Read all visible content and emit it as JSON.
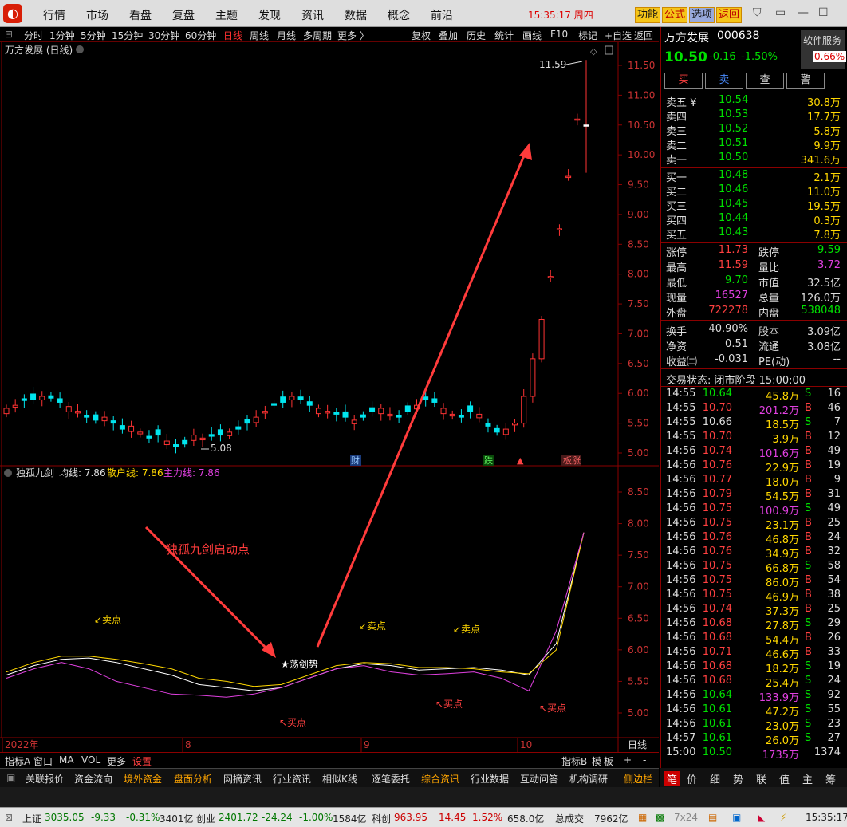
{
  "menu": {
    "items": [
      "行情",
      "市场",
      "看盘",
      "复盘",
      "主题",
      "发现",
      "资讯",
      "数据",
      "概念",
      "前沿"
    ],
    "clock": "15:35:17 周四",
    "func": [
      "功能",
      "公式",
      "选项",
      "返回"
    ]
  },
  "tf": {
    "items": [
      "分时",
      "1分钟",
      "5分钟",
      "15分钟",
      "30分钟",
      "60分钟",
      "日线",
      "周线",
      "月线",
      "多周期",
      "更多 〉"
    ],
    "tools": [
      "复权",
      "叠加",
      "历史",
      "统计",
      "画线",
      "F10",
      "标记",
      "+自选",
      "返回"
    ]
  },
  "chart": {
    "title": "万方发展 (日线)",
    "ind_title": "独孤九剑",
    "ind_avg": "均线: 7.86",
    "ind_retail": "散户线: 7.86",
    "ind_main": "主力线: 7.86",
    "yticks": [
      "11.50",
      "11.00",
      "10.50",
      "10.00",
      "9.50",
      "9.00",
      "8.50",
      "8.00",
      "7.50",
      "7.00",
      "6.50",
      "6.00",
      "5.50",
      "5.00"
    ],
    "yticks2": [
      "8.50",
      "8.00",
      "7.50",
      "7.00",
      "6.50",
      "6.00",
      "5.50",
      "5.00"
    ],
    "high_label": "11.59",
    "low_label": "5.08",
    "xlabels": [
      "2022年",
      "8",
      "9",
      "10"
    ],
    "xlast": "日线",
    "ann_launch": "独孤九剑启动点",
    "ann_sell": "卖点",
    "ann_buy": "买点",
    "ann_sword": "★荡剑势",
    "badge_cai": "财",
    "badge_die": "跌",
    "badge_zt": "涨"
  },
  "chart_data": [
    {
      "type": "candlestick",
      "title": "万方发展 (日线)",
      "ylim": [
        4.95,
        11.75
      ],
      "x": [
        "2022-06",
        "2022-07",
        "2022-08",
        "2022-09",
        "2022-10"
      ],
      "closes": [
        5.75,
        5.8,
        5.88,
        5.9,
        5.95,
        5.92,
        5.85,
        5.78,
        5.7,
        5.6,
        5.55,
        5.6,
        5.5,
        5.4,
        5.45,
        5.35,
        5.25,
        5.3,
        5.2,
        5.1,
        5.15,
        5.3,
        5.25,
        5.28,
        5.3,
        5.35,
        5.4,
        5.5,
        5.6,
        5.7,
        5.8,
        5.85,
        5.95,
        5.9,
        5.8,
        5.75,
        5.7,
        5.65,
        5.6,
        5.55,
        5.6,
        5.7,
        5.75,
        5.65,
        5.6,
        5.7,
        5.8,
        5.9,
        5.85,
        5.75,
        5.65,
        5.6,
        5.7,
        5.65,
        5.45,
        5.35,
        5.4,
        5.5,
        5.95,
        6.58,
        7.24,
        7.96,
        8.76,
        9.64,
        10.6,
        10.5
      ]
    },
    {
      "type": "line",
      "title": "独孤九剑",
      "ylim": [
        4.85,
        8.9
      ],
      "series": [
        {
          "name": "均线",
          "values": [
            5.6,
            5.75,
            5.85,
            5.87,
            5.8,
            5.7,
            5.6,
            5.45,
            5.4,
            5.35,
            5.4,
            5.55,
            5.7,
            5.78,
            5.75,
            5.68,
            5.7,
            5.72,
            5.68,
            5.6,
            6.1,
            7.86
          ]
        },
        {
          "name": "散户线",
          "values": [
            5.65,
            5.8,
            5.9,
            5.9,
            5.85,
            5.78,
            5.7,
            5.55,
            5.5,
            5.42,
            5.45,
            5.6,
            5.75,
            5.8,
            5.78,
            5.72,
            5.72,
            5.7,
            5.65,
            5.62,
            6.0,
            7.86
          ]
        },
        {
          "name": "主力线",
          "values": [
            5.55,
            5.7,
            5.8,
            5.7,
            5.5,
            5.4,
            5.3,
            5.28,
            5.25,
            5.3,
            5.4,
            5.55,
            5.7,
            5.75,
            5.65,
            5.6,
            5.62,
            5.65,
            5.55,
            5.35,
            6.3,
            7.86
          ]
        }
      ]
    }
  ],
  "quote": {
    "name": "万方发展",
    "code": "000638",
    "svc": "软件服务",
    "price": "10.50",
    "chg": "-0.16",
    "pct": "-1.50%",
    "rate": "0.66%",
    "btns": [
      "买",
      "卖",
      "查",
      "警"
    ],
    "sells": [
      [
        "卖五 ¥",
        "10.54",
        "30.8万"
      ],
      [
        "卖四",
        "10.53",
        "17.7万"
      ],
      [
        "卖三",
        "10.52",
        "5.8万"
      ],
      [
        "卖二",
        "10.51",
        "9.9万"
      ],
      [
        "卖一",
        "10.50",
        "341.6万"
      ]
    ],
    "buys": [
      [
        "买一",
        "10.48",
        "2.1万"
      ],
      [
        "买二",
        "10.46",
        "11.0万"
      ],
      [
        "买三",
        "10.45",
        "19.5万"
      ],
      [
        "买四",
        "10.44",
        "0.3万"
      ],
      [
        "买五",
        "10.43",
        "7.8万"
      ]
    ],
    "stats": [
      [
        "涨停",
        "11.73",
        "跌停",
        "9.59"
      ],
      [
        "最高",
        "11.59",
        "量比",
        "3.72"
      ],
      [
        "最低",
        "9.70",
        "市值",
        "32.5亿"
      ],
      [
        "现量",
        "16527",
        "总量",
        "126.0万"
      ],
      [
        "外盘",
        "722278",
        "内盘",
        "538048"
      ]
    ],
    "stats2": [
      [
        "换手",
        "40.90%",
        "股本",
        "3.09亿"
      ],
      [
        "净资",
        "0.51",
        "流通",
        "3.08亿"
      ],
      [
        "收益㈡",
        "-0.031",
        "PE(动)",
        "--"
      ]
    ],
    "trade_state": "交易状态: 闭市阶段 15:00:00",
    "ticks": [
      [
        "14:55",
        "10.64",
        "45.8万",
        "S",
        "16"
      ],
      [
        "14:55",
        "10.70",
        "201.2万",
        "B",
        "46"
      ],
      [
        "14:55",
        "10.66",
        "18.5万",
        "S",
        "7"
      ],
      [
        "14:55",
        "10.70",
        "3.9万",
        "B",
        "12"
      ],
      [
        "14:56",
        "10.74",
        "101.6万",
        "B",
        "49"
      ],
      [
        "14:56",
        "10.76",
        "22.9万",
        "B",
        "19"
      ],
      [
        "14:56",
        "10.77",
        "18.0万",
        "B",
        "9"
      ],
      [
        "14:56",
        "10.79",
        "54.5万",
        "B",
        "31"
      ],
      [
        "14:56",
        "10.75",
        "100.9万",
        "S",
        "49"
      ],
      [
        "14:56",
        "10.75",
        "23.1万",
        "B",
        "25"
      ],
      [
        "14:56",
        "10.76",
        "46.8万",
        "B",
        "24"
      ],
      [
        "14:56",
        "10.76",
        "34.9万",
        "B",
        "32"
      ],
      [
        "14:56",
        "10.75",
        "66.8万",
        "S",
        "58"
      ],
      [
        "14:56",
        "10.75",
        "86.0万",
        "B",
        "54"
      ],
      [
        "14:56",
        "10.75",
        "46.9万",
        "B",
        "38"
      ],
      [
        "14:56",
        "10.74",
        "37.3万",
        "B",
        "25"
      ],
      [
        "14:56",
        "10.68",
        "27.8万",
        "S",
        "29"
      ],
      [
        "14:56",
        "10.68",
        "54.4万",
        "B",
        "26"
      ],
      [
        "14:56",
        "10.71",
        "46.6万",
        "B",
        "33"
      ],
      [
        "14:56",
        "10.68",
        "18.2万",
        "S",
        "19"
      ],
      [
        "14:56",
        "10.68",
        "25.4万",
        "S",
        "24"
      ],
      [
        "14:56",
        "10.64",
        "133.9万",
        "S",
        "92"
      ],
      [
        "14:56",
        "10.61",
        "47.2万",
        "S",
        "55"
      ],
      [
        "14:56",
        "10.61",
        "23.0万",
        "S",
        "23"
      ],
      [
        "14:57",
        "10.61",
        "26.0万",
        "S",
        "27"
      ],
      [
        "15:00",
        "10.50",
        "1735万",
        "",
        "1374"
      ]
    ]
  },
  "bottom": {
    "ind_tabs": [
      "指标A",
      "窗口",
      "MA",
      "VOL",
      "更多",
      "设置"
    ],
    "right": [
      "指标B",
      "模",
      "板",
      "+",
      "-"
    ],
    "tabs": [
      "关联报价",
      "资金流向",
      "境外资金",
      "盘面分析",
      "网摘资讯",
      "行业资讯",
      "相似K线",
      "逐笔委托",
      "综合资讯",
      "行业数据",
      "互动问答",
      "机构调研",
      "侧边栏"
    ],
    "rtabs": [
      "笔",
      "价",
      "细",
      "势",
      "联",
      "值",
      "主",
      "筹"
    ]
  },
  "status": {
    "sh": "上证",
    "sh_v": "3035.05",
    "sh_c": "-9.33",
    "sh_p": "-0.31%",
    "sh_a": "3401亿",
    "cy": "创业",
    "cy_v": "2401.72",
    "cy_c": "-24.24",
    "cy_p": "-1.00%",
    "cy_a": "1584亿",
    "kc": "科创",
    "kc_v": "963.95",
    "kc_c": "14.45",
    "kc_p": "1.52%",
    "kc_a": "658.0亿",
    "tot": "总成交",
    "tot_v": "7962亿",
    "time": "15:35:17",
    "grid": "7x24"
  }
}
